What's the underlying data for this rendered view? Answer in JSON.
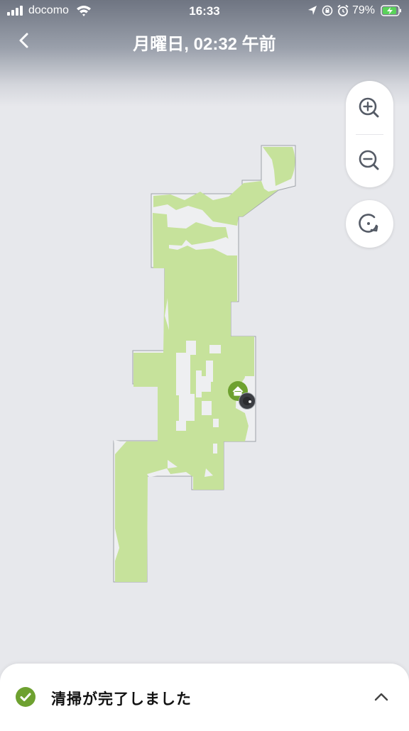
{
  "status_bar": {
    "carrier": "docomo",
    "time": "16:33",
    "battery_percent": "79%"
  },
  "header": {
    "title": "月曜日, 02:32 午前"
  },
  "controls": {
    "zoom_in_icon": "zoom-in-icon",
    "zoom_out_icon": "zoom-out-icon",
    "recenter_icon": "rotate-icon"
  },
  "map": {
    "cleaned_color": "#c6e29b",
    "uncleaned_color": "#eeeff1",
    "dock_icon": "home-icon",
    "robot_icon": "robot-icon",
    "dock_color": "#6ea130"
  },
  "bottom_sheet": {
    "message": "清掃が完了しました",
    "status_icon": "check-circle-icon",
    "status_color": "#6ea130",
    "expand_icon": "chevron-up-icon"
  }
}
